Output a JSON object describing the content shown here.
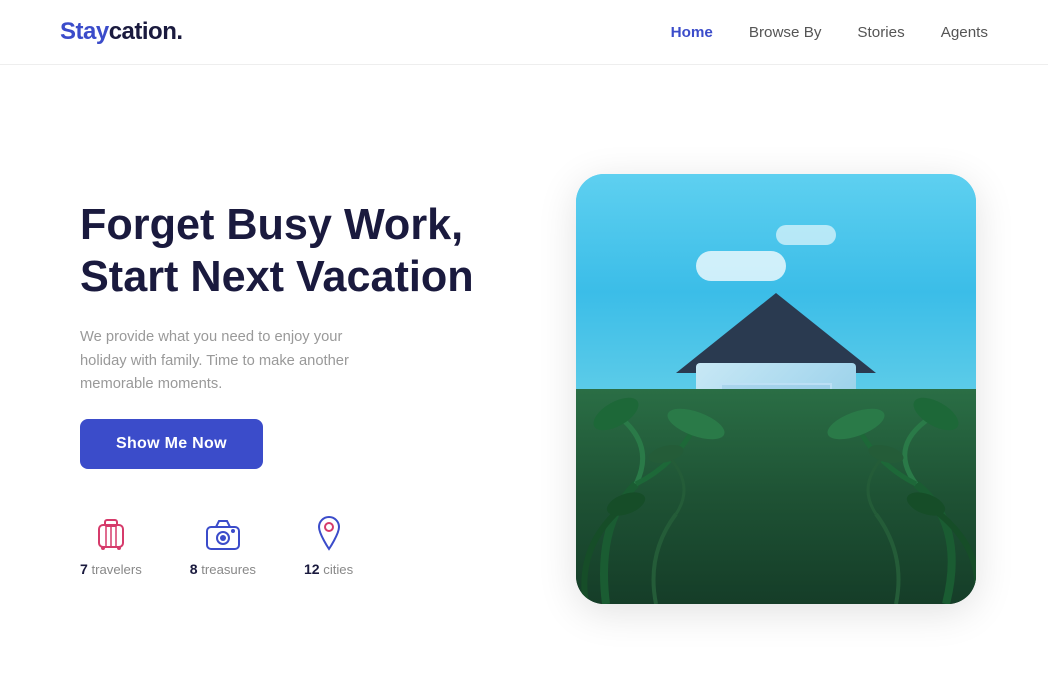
{
  "header": {
    "logo_stay": "Stay",
    "logo_rest": "cation.",
    "nav": [
      {
        "label": "Home",
        "active": true,
        "id": "home"
      },
      {
        "label": "Browse By",
        "active": false,
        "id": "browse-by"
      },
      {
        "label": "Stories",
        "active": false,
        "id": "stories"
      },
      {
        "label": "Agents",
        "active": false,
        "id": "agents"
      }
    ]
  },
  "hero": {
    "title_line1": "Forget Busy Work,",
    "title_line2": "Start Next Vacation",
    "subtitle": "We provide what you need to enjoy your holiday with family. Time to make another memorable moments.",
    "cta_label": "Show Me Now"
  },
  "stats": [
    {
      "count": "7",
      "label": "travelers",
      "icon": "luggage"
    },
    {
      "count": "8",
      "label": "treasures",
      "icon": "camera"
    },
    {
      "count": "12",
      "label": "cities",
      "icon": "location"
    }
  ],
  "colors": {
    "accent": "#3b4cca",
    "dark": "#1a1a3e",
    "muted": "#999999"
  }
}
